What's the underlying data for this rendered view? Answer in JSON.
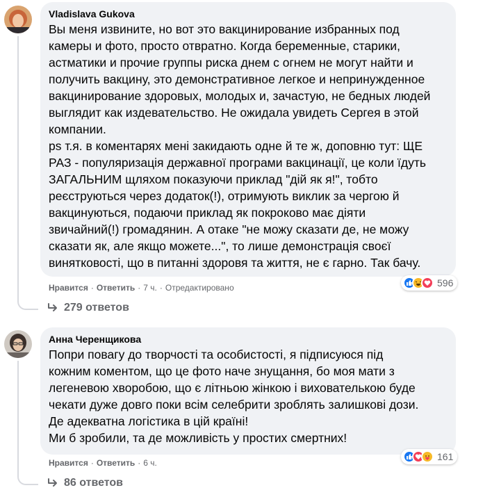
{
  "comments": [
    {
      "author": "Vladislava Gukova",
      "text": "Вы меня извините, но вот это вакцинирование избранных под\nкамеры и фото, просто отвратно. Когда беременные, старики,\nастматики и прочие группы риска днем с огнем не могут найти и\nполучить вакцину, это демонстративное легкое и непринужденное\nвакцинирование здоровых, молодых и, зачастую, не бедных людей\nвыглядит как издевательство. Не ожидала увидеть Сергея в этой\nкомпании.\nps т.я. в коментарях мені закидають одне й те ж, доповню тут: ЩЕ\nРАЗ - популяризація державної програми вакцинації, це коли їдуть\nЗАГАЛЬНИМ щляхом показуючи приклад \"дій як я!\", тобто\nреєструються через додаток(!), отримують виклик за чергою й\nвакцинуються, подаючи приклад як покроково має діяти\nзвичайний(!) громадянин. А отаке \"не можу сказати де, не можу\nсказати як, але якщо можете...\", то лише демонстрація своєї\nвинятковості, що в питанні здоровя та життя, не є гарно. Так бачу.",
      "like_label": "Нравится",
      "reply_label": "Ответить",
      "time": "7 ч.",
      "edited": "Отредактировано",
      "reaction_count": "596",
      "replies_label": "279 ответов",
      "avatar_color": "#e0955f"
    },
    {
      "author": "Анна Черенщикова",
      "text": "Попри повагу до творчості та особистості, я підписуюся під\nкожним коментом, що це фото наче знущання, бо моя мати з\nлегеневою хворобою, що є літньою жінкою і вихователькою буде\nчекати дуже довго поки всім селебрити зроблять залишкові дози.\nДе адекватна логістика в цій країні!\nМи б зробили, та де можливість у простих смертних!",
      "like_label": "Нравится",
      "reply_label": "Ответить",
      "time": "6 ч.",
      "reaction_count": "161",
      "replies_label": "86 ответов",
      "avatar_color": "#b9b2ab"
    }
  ],
  "colors": {
    "like_blue": "#1877f2",
    "love_red": "#f33e58",
    "haha_yellow": "#f7b928",
    "secondary_text": "#65676b",
    "bubble_bg": "#f0f2f5"
  }
}
